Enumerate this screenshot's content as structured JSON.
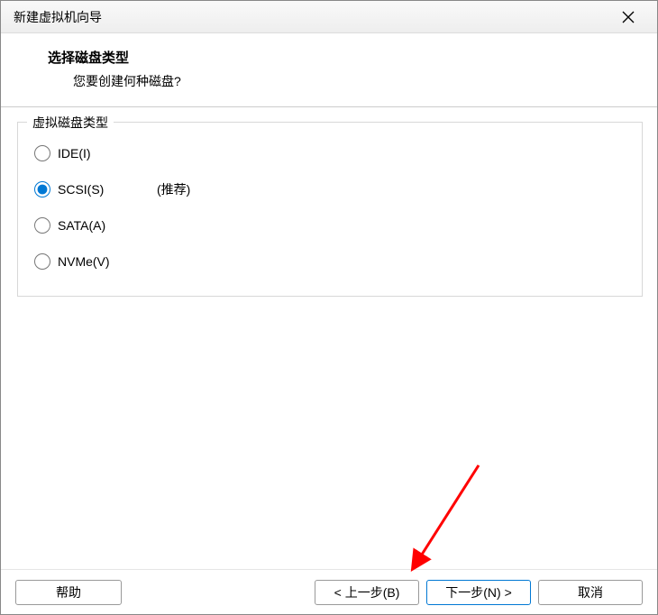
{
  "titlebar": {
    "title": "新建虚拟机向导"
  },
  "header": {
    "title": "选择磁盘类型",
    "subtitle": "您要创建何种磁盘?"
  },
  "group": {
    "title": "虚拟磁盘类型",
    "options": [
      {
        "label": "IDE(I)",
        "recommend": ""
      },
      {
        "label": "SCSI(S)",
        "recommend": "(推荐)"
      },
      {
        "label": "SATA(A)",
        "recommend": ""
      },
      {
        "label": "NVMe(V)",
        "recommend": ""
      }
    ],
    "selected": 1
  },
  "footer": {
    "help": "帮助",
    "back": "< 上一步(B)",
    "next": "下一步(N) >",
    "cancel": "取消"
  }
}
